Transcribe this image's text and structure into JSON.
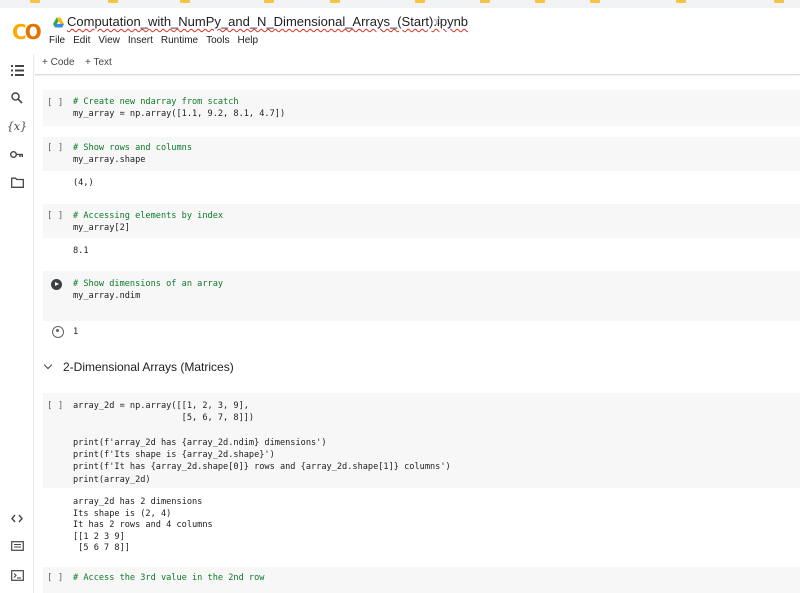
{
  "bookmarks": [],
  "header": {
    "title": "Computation_with_NumPy_and_N_Dimensional_Arrays_(Start).ipynb",
    "menu": [
      "File",
      "Edit",
      "View",
      "Insert",
      "Runtime",
      "Tools",
      "Help"
    ]
  },
  "toolbar": {
    "add_code": "+ Code",
    "add_text": "+ Text"
  },
  "cells": [
    {
      "gutter": "[ ]",
      "lines": [
        "# Create new ndarray from scatch",
        "my_array = np.array([1.1, 9.2, 8.1, 4.7])"
      ]
    },
    {
      "gutter": "[ ]",
      "lines": [
        "# Show rows and columns",
        "my_array.shape"
      ],
      "output": "(4,)"
    },
    {
      "gutter": "[ ]",
      "lines": [
        "# Accessing elements by index",
        "my_array[2]"
      ],
      "output": "8.1"
    },
    {
      "gutter": "",
      "lines": [
        "# Show dimensions of an array",
        "my_array.ndim"
      ],
      "output": "1"
    },
    {
      "gutter": "[ ]",
      "lines": [
        "array_2d = np.array([[1, 2, 3, 9],",
        "                     [5, 6, 7, 8]])",
        "",
        "print(f'array_2d has {array_2d.ndim} dimensions')",
        "print(f'Its shape is {array_2d.shape}')",
        "print(f'It has {array_2d.shape[0]} rows and {array_2d.shape[1]} columns')",
        "print(array_2d)"
      ],
      "output": "array_2d has 2 dimensions\nIts shape is (2, 4)\nIt has 2 rows and 4 columns\n[[1 2 3 9]\n [5 6 7 8]]"
    },
    {
      "gutter": "[ ]",
      "lines": [
        "# Access the 3rd value in the 2nd row"
      ]
    }
  ],
  "section": {
    "title": "2-Dimensional Arrays (Matrices)"
  },
  "colors": {
    "accent": "#f9ab00",
    "comment": "#0b7a28",
    "cell_bg": "#f7f7f7"
  }
}
